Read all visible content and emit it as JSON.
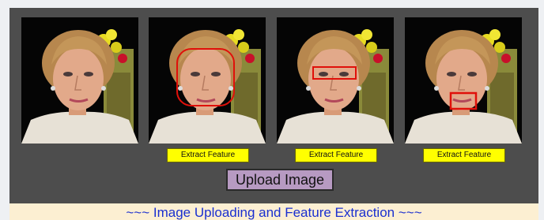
{
  "images": [
    {
      "name": "original",
      "overlay": "none"
    },
    {
      "name": "face-detected",
      "overlay": "face"
    },
    {
      "name": "eyes-detected",
      "overlay": "eyes"
    },
    {
      "name": "mouth-detected",
      "overlay": "mouth"
    }
  ],
  "buttons": {
    "extract_label": "Extract Feature",
    "upload_label": "Upload Image"
  },
  "footer": {
    "caption": "~~~ Image Uploading and Feature Extraction ~~~"
  },
  "colors": {
    "panel": "#4d4d4d",
    "extract_button": "#ffff00",
    "upload_button": "#b79ac2",
    "footer_background": "#fcefd2",
    "footer_text": "#1a2fd0",
    "detection_box": "#e0100a"
  }
}
